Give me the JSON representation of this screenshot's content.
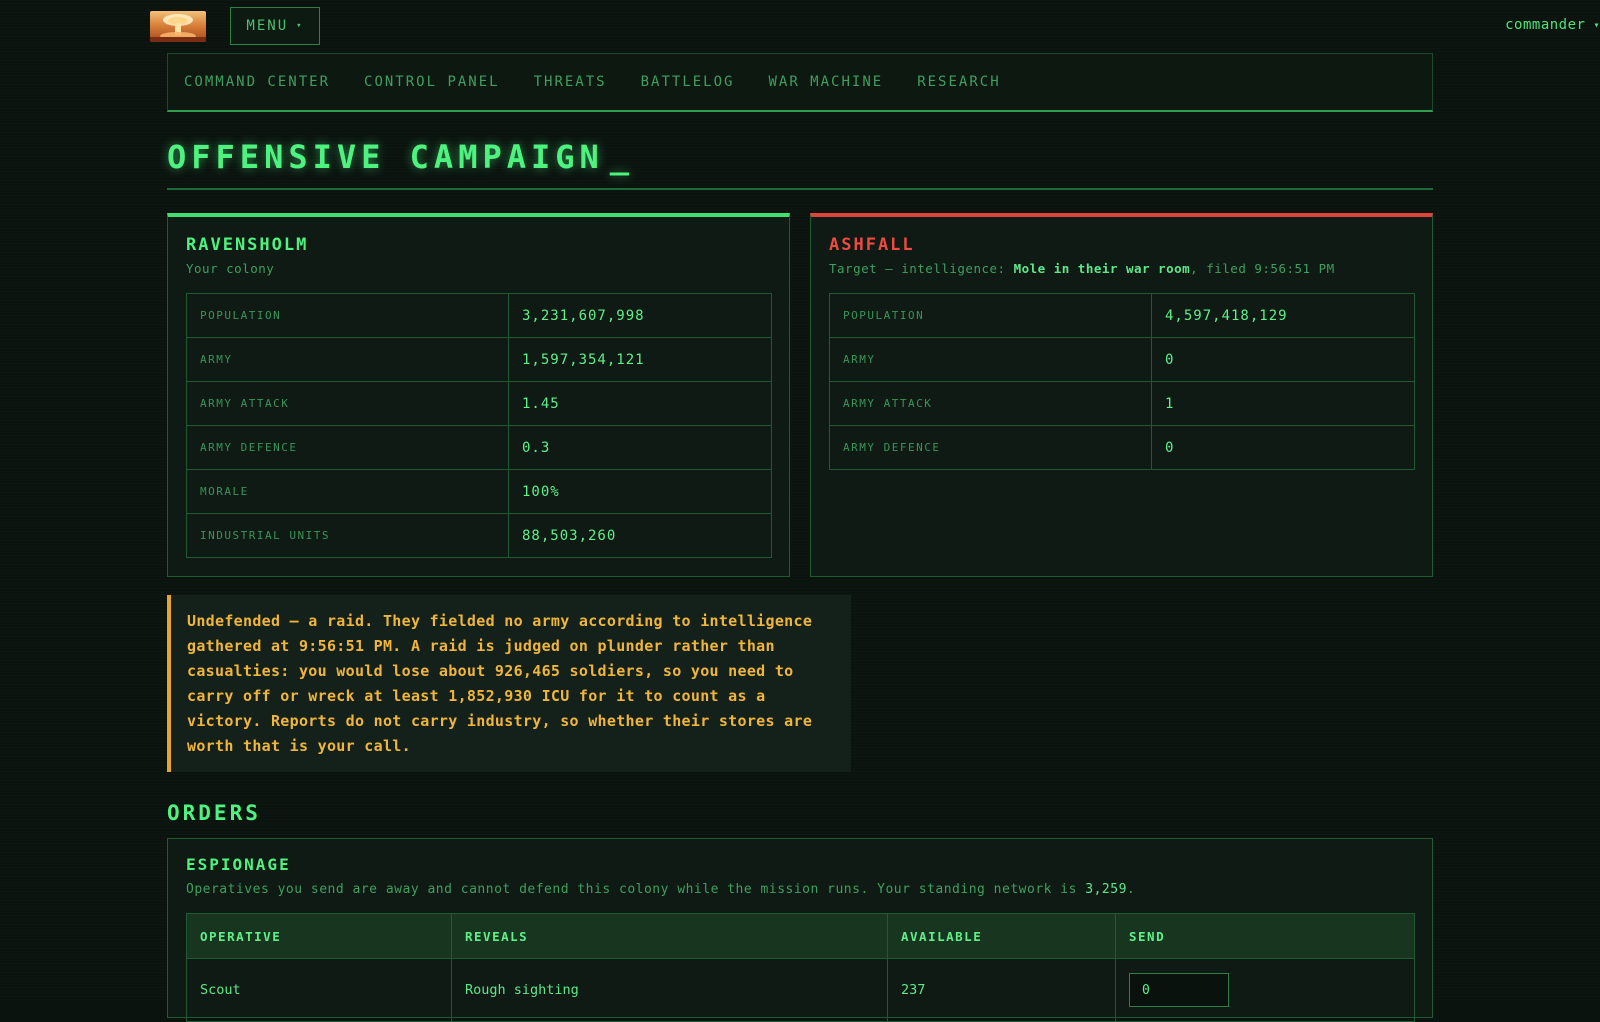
{
  "header": {
    "menu_label": "MENU",
    "user_label": "commander"
  },
  "nav": {
    "items": [
      "COMMAND CENTER",
      "CONTROL PANEL",
      "THREATS",
      "BATTLELOG",
      "WAR MACHINE",
      "RESEARCH"
    ]
  },
  "page": {
    "title": "OFFENSIVE CAMPAIGN",
    "cursor": "_"
  },
  "colony": {
    "name": "RAVENSHOLM",
    "subtitle": "Your colony",
    "stats": [
      {
        "label": "POPULATION",
        "value": "3,231,607,998"
      },
      {
        "label": "ARMY",
        "value": "1,597,354,121"
      },
      {
        "label": "ARMY ATTACK",
        "value": "1.45"
      },
      {
        "label": "ARMY DEFENCE",
        "value": "0.3"
      },
      {
        "label": "MORALE",
        "value": "100%"
      },
      {
        "label": "INDUSTRIAL UNITS",
        "value": "88,503,260"
      }
    ]
  },
  "target": {
    "name": "ASHFALL",
    "subtitle_prefix": "Target — intelligence: ",
    "subtitle_source": "Mole in their war room",
    "subtitle_suffix": ", filed 9:56:51 PM",
    "stats": [
      {
        "label": "POPULATION",
        "value": "4,597,418,129"
      },
      {
        "label": "ARMY",
        "value": "0"
      },
      {
        "label": "ARMY ATTACK",
        "value": "1"
      },
      {
        "label": "ARMY DEFENCE",
        "value": "0"
      }
    ]
  },
  "warning": {
    "text": "Undefended — a raid. They fielded no army according to intelligence gathered at 9:56:51 PM. A raid is judged on plunder rather than casualties: you would lose about 926,465 soldiers, so you need to carry off or wreck at least 1,852,930 ICU for it to count as a victory. Reports do not carry industry, so whether their stores are worth that is your call."
  },
  "orders": {
    "title": "ORDERS",
    "espionage": {
      "title": "ESPIONAGE",
      "desc_prefix": "Operatives you send are away and cannot defend this colony while the mission runs. Your standing network is ",
      "desc_count": "3,259",
      "desc_suffix": ".",
      "columns": [
        "OPERATIVE",
        "REVEALS",
        "AVAILABLE",
        "SEND"
      ],
      "rows": [
        {
          "operative": "Scout",
          "reveals": "Rough sighting",
          "available": "237",
          "send": "0"
        }
      ]
    }
  },
  "colors": {
    "accent": "#4df27f",
    "hostile": "#ef4a40",
    "warning": "#f0b53a",
    "background": "#0b130f"
  },
  "icons": {
    "logo": "mushroom-cloud-logo",
    "menu_caret": "chevron-down-icon",
    "user_caret": "chevron-down-icon"
  }
}
